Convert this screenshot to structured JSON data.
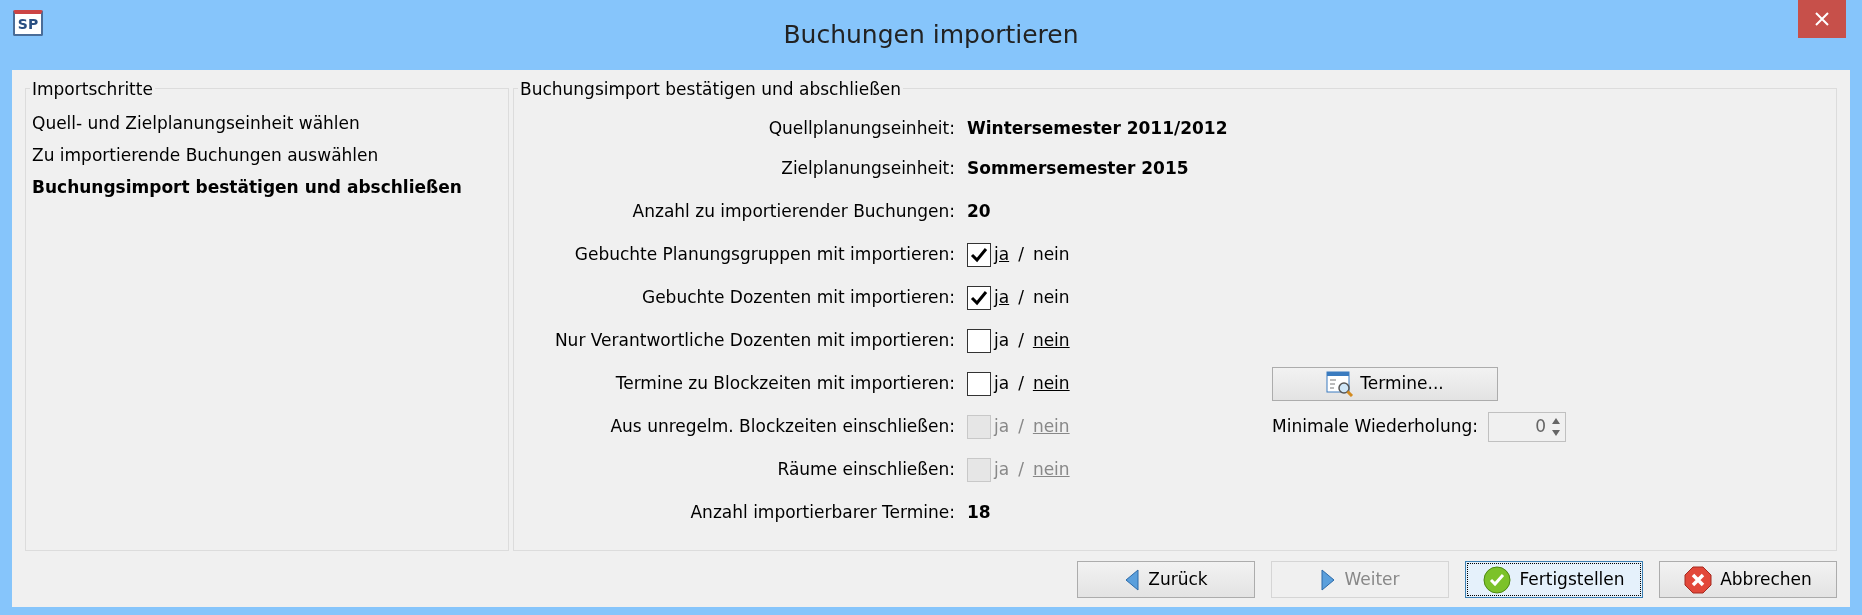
{
  "window": {
    "title": "Buchungen importieren",
    "app_icon_text": "SP"
  },
  "steps": {
    "title": "Importschritte",
    "items": [
      {
        "label": "Quell- und Zielplanungseinheit wählen",
        "selected": false
      },
      {
        "label": "Zu importierende Buchungen auswählen",
        "selected": false
      },
      {
        "label": "Buchungsimport bestätigen und abschließen",
        "selected": true
      }
    ]
  },
  "form": {
    "title": "Buchungsimport bestätigen und abschließen",
    "rows": [
      {
        "kind": "value",
        "label": "Quellplanungseinheit:",
        "value": "Wintersemester 2011/2012"
      },
      {
        "kind": "value",
        "label": "Zielplanungseinheit:",
        "value": "Sommersemester 2015"
      },
      {
        "kind": "value",
        "label": "Anzahl zu importierender Buchungen:",
        "value": "20"
      },
      {
        "kind": "checkbox",
        "label": "Gebuchte Planungsgruppen mit importieren:",
        "checked": true,
        "disabled": false,
        "yes": "ja",
        "sep": "/",
        "no": "nein"
      },
      {
        "kind": "checkbox",
        "label": "Gebuchte Dozenten mit importieren:",
        "checked": true,
        "disabled": false,
        "yes": "ja",
        "sep": "/",
        "no": "nein"
      },
      {
        "kind": "checkbox",
        "label": "Nur Verantwortliche Dozenten mit importieren:",
        "checked": false,
        "disabled": false,
        "yes": "ja",
        "sep": "/",
        "no": "nein"
      },
      {
        "kind": "checkbox",
        "label": "Termine zu Blockzeiten mit importieren:",
        "checked": false,
        "disabled": false,
        "yes": "ja",
        "sep": "/",
        "no": "nein",
        "extra": {
          "kind": "button",
          "label": "Termine..."
        }
      },
      {
        "kind": "checkbox",
        "label": "Aus unregelm. Blockzeiten einschließen:",
        "checked": false,
        "disabled": true,
        "yes": "ja",
        "sep": "/",
        "no": "nein",
        "extra": {
          "kind": "spinner",
          "label": "Minimale Wiederholung:",
          "value": "0",
          "disabled": true
        }
      },
      {
        "kind": "checkbox",
        "label": "Räume einschließen:",
        "checked": false,
        "disabled": true,
        "yes": "ja",
        "sep": "/",
        "no": "nein"
      },
      {
        "kind": "value",
        "label": "Anzahl importierbarer Termine:",
        "value": "18"
      }
    ]
  },
  "buttons": [
    {
      "kind": "back",
      "label": "Zurück",
      "disabled": false,
      "focused": false
    },
    {
      "kind": "next",
      "label": "Weiter",
      "disabled": true,
      "focused": false
    },
    {
      "kind": "finish",
      "label": "Fertigstellen",
      "disabled": false,
      "focused": true
    },
    {
      "kind": "cancel",
      "label": "Abbrechen",
      "disabled": false,
      "focused": false
    }
  ]
}
